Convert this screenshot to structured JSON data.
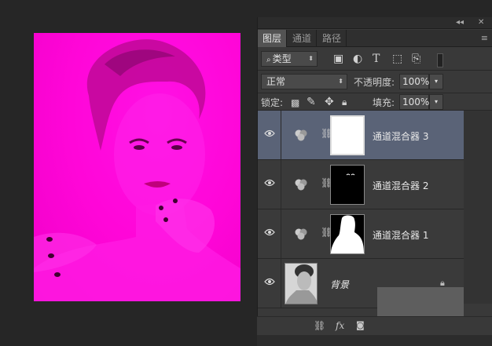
{
  "window_controls": {
    "collapse": "◂◂",
    "close": "✕"
  },
  "tabs": [
    {
      "label": "图层",
      "active": true
    },
    {
      "label": "通道",
      "active": false
    },
    {
      "label": "路径",
      "active": false
    }
  ],
  "panel_menu_icon": "≡",
  "filter": {
    "kind_label": "类型"
  },
  "blend_mode": {
    "value": "正常"
  },
  "opacity": {
    "label": "不透明度:",
    "value": "100%"
  },
  "lock": {
    "label": "锁定:"
  },
  "fill": {
    "label": "填充:",
    "value": "100%"
  },
  "layers": [
    {
      "name": "通道混合器 3",
      "type": "adjustment",
      "mask": "white",
      "selected": true
    },
    {
      "name": "通道混合器 2",
      "type": "adjustment",
      "mask": "black",
      "selected": false
    },
    {
      "name": "通道混合器 1",
      "type": "adjustment",
      "mask": "silhouette",
      "selected": false
    },
    {
      "name": "背景",
      "type": "background",
      "mask": "photo",
      "selected": false
    }
  ],
  "bottom_icons": [
    "link-layers",
    "fx",
    "add-mask"
  ],
  "colors": {
    "canvas_tint": "#ff10e4",
    "selected_layer": "#5a6377",
    "panel_bg": "#393939"
  }
}
